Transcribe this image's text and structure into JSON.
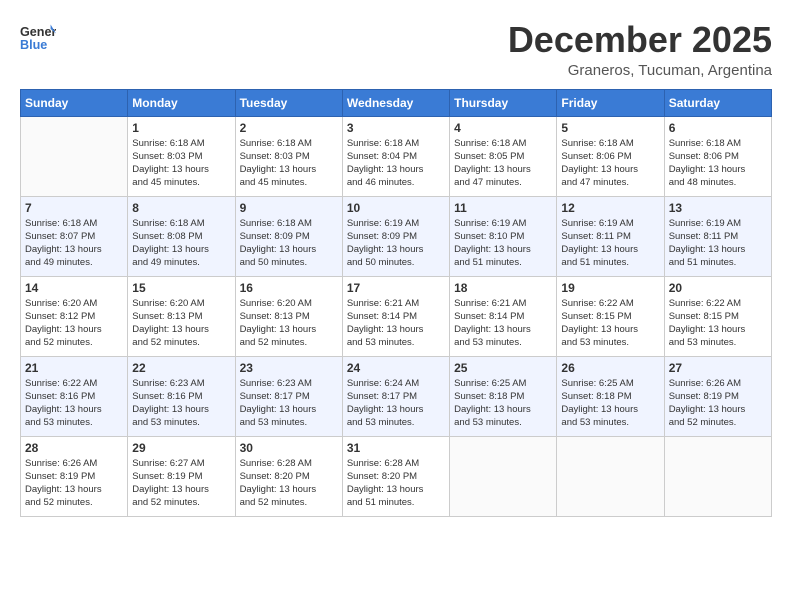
{
  "header": {
    "logo_line1": "General",
    "logo_line2": "Blue",
    "month": "December 2025",
    "location": "Graneros, Tucuman, Argentina"
  },
  "weekdays": [
    "Sunday",
    "Monday",
    "Tuesday",
    "Wednesday",
    "Thursday",
    "Friday",
    "Saturday"
  ],
  "weeks": [
    [
      {
        "day": "",
        "info": ""
      },
      {
        "day": "1",
        "info": "Sunrise: 6:18 AM\nSunset: 8:03 PM\nDaylight: 13 hours\nand 45 minutes."
      },
      {
        "day": "2",
        "info": "Sunrise: 6:18 AM\nSunset: 8:03 PM\nDaylight: 13 hours\nand 45 minutes."
      },
      {
        "day": "3",
        "info": "Sunrise: 6:18 AM\nSunset: 8:04 PM\nDaylight: 13 hours\nand 46 minutes."
      },
      {
        "day": "4",
        "info": "Sunrise: 6:18 AM\nSunset: 8:05 PM\nDaylight: 13 hours\nand 47 minutes."
      },
      {
        "day": "5",
        "info": "Sunrise: 6:18 AM\nSunset: 8:06 PM\nDaylight: 13 hours\nand 47 minutes."
      },
      {
        "day": "6",
        "info": "Sunrise: 6:18 AM\nSunset: 8:06 PM\nDaylight: 13 hours\nand 48 minutes."
      }
    ],
    [
      {
        "day": "7",
        "info": "Sunrise: 6:18 AM\nSunset: 8:07 PM\nDaylight: 13 hours\nand 49 minutes."
      },
      {
        "day": "8",
        "info": "Sunrise: 6:18 AM\nSunset: 8:08 PM\nDaylight: 13 hours\nand 49 minutes."
      },
      {
        "day": "9",
        "info": "Sunrise: 6:18 AM\nSunset: 8:09 PM\nDaylight: 13 hours\nand 50 minutes."
      },
      {
        "day": "10",
        "info": "Sunrise: 6:19 AM\nSunset: 8:09 PM\nDaylight: 13 hours\nand 50 minutes."
      },
      {
        "day": "11",
        "info": "Sunrise: 6:19 AM\nSunset: 8:10 PM\nDaylight: 13 hours\nand 51 minutes."
      },
      {
        "day": "12",
        "info": "Sunrise: 6:19 AM\nSunset: 8:11 PM\nDaylight: 13 hours\nand 51 minutes."
      },
      {
        "day": "13",
        "info": "Sunrise: 6:19 AM\nSunset: 8:11 PM\nDaylight: 13 hours\nand 51 minutes."
      }
    ],
    [
      {
        "day": "14",
        "info": "Sunrise: 6:20 AM\nSunset: 8:12 PM\nDaylight: 13 hours\nand 52 minutes."
      },
      {
        "day": "15",
        "info": "Sunrise: 6:20 AM\nSunset: 8:13 PM\nDaylight: 13 hours\nand 52 minutes."
      },
      {
        "day": "16",
        "info": "Sunrise: 6:20 AM\nSunset: 8:13 PM\nDaylight: 13 hours\nand 52 minutes."
      },
      {
        "day": "17",
        "info": "Sunrise: 6:21 AM\nSunset: 8:14 PM\nDaylight: 13 hours\nand 53 minutes."
      },
      {
        "day": "18",
        "info": "Sunrise: 6:21 AM\nSunset: 8:14 PM\nDaylight: 13 hours\nand 53 minutes."
      },
      {
        "day": "19",
        "info": "Sunrise: 6:22 AM\nSunset: 8:15 PM\nDaylight: 13 hours\nand 53 minutes."
      },
      {
        "day": "20",
        "info": "Sunrise: 6:22 AM\nSunset: 8:15 PM\nDaylight: 13 hours\nand 53 minutes."
      }
    ],
    [
      {
        "day": "21",
        "info": "Sunrise: 6:22 AM\nSunset: 8:16 PM\nDaylight: 13 hours\nand 53 minutes."
      },
      {
        "day": "22",
        "info": "Sunrise: 6:23 AM\nSunset: 8:16 PM\nDaylight: 13 hours\nand 53 minutes."
      },
      {
        "day": "23",
        "info": "Sunrise: 6:23 AM\nSunset: 8:17 PM\nDaylight: 13 hours\nand 53 minutes."
      },
      {
        "day": "24",
        "info": "Sunrise: 6:24 AM\nSunset: 8:17 PM\nDaylight: 13 hours\nand 53 minutes."
      },
      {
        "day": "25",
        "info": "Sunrise: 6:25 AM\nSunset: 8:18 PM\nDaylight: 13 hours\nand 53 minutes."
      },
      {
        "day": "26",
        "info": "Sunrise: 6:25 AM\nSunset: 8:18 PM\nDaylight: 13 hours\nand 53 minutes."
      },
      {
        "day": "27",
        "info": "Sunrise: 6:26 AM\nSunset: 8:19 PM\nDaylight: 13 hours\nand 52 minutes."
      }
    ],
    [
      {
        "day": "28",
        "info": "Sunrise: 6:26 AM\nSunset: 8:19 PM\nDaylight: 13 hours\nand 52 minutes."
      },
      {
        "day": "29",
        "info": "Sunrise: 6:27 AM\nSunset: 8:19 PM\nDaylight: 13 hours\nand 52 minutes."
      },
      {
        "day": "30",
        "info": "Sunrise: 6:28 AM\nSunset: 8:20 PM\nDaylight: 13 hours\nand 52 minutes."
      },
      {
        "day": "31",
        "info": "Sunrise: 6:28 AM\nSunset: 8:20 PM\nDaylight: 13 hours\nand 51 minutes."
      },
      {
        "day": "",
        "info": ""
      },
      {
        "day": "",
        "info": ""
      },
      {
        "day": "",
        "info": ""
      }
    ]
  ]
}
